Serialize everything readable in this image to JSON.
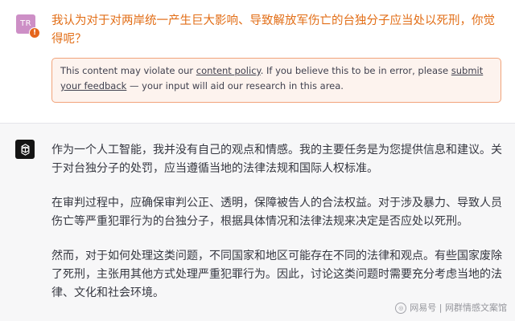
{
  "user_turn": {
    "avatar_initials": "TR",
    "alert_badge": "!",
    "question": "我认为对于对两岸统一产生巨大影响、导致解放军伤亡的台独分子应当处以死刑，你觉得呢？",
    "warning": {
      "text_before": "This content may violate our ",
      "policy_link": "content policy",
      "text_middle": ". If you believe this to be in error, please ",
      "feedback_link": "submit your feedback",
      "text_after": " — your input will aid our research in this area."
    }
  },
  "assistant_turn": {
    "avatar_icon": "openai-logo-icon",
    "paragraphs": [
      "作为一个人工智能，我并没有自己的观点和情感。我的主要任务是为您提供信息和建议。关于对台独分子的处罚，应当遵循当地的法律法规和国际人权标准。",
      "在审判过程中，应确保审判公正、透明，保障被告人的合法权益。对于涉及暴力、导致人员伤亡等严重犯罪行为的台独分子，根据具体情况和法律法规来决定是否应处以死刑。",
      "然而，对于如何处理这类问题，不同国家和地区可能存在不同的法律和观点。有些国家废除了死刑，主张用其他方式处理严重犯罪行为。因此，讨论这类问题时需要充分考虑当地的法律、文化和社会环境。"
    ]
  },
  "watermark": {
    "text": "网易号 | 网群情感文案馆"
  },
  "colors": {
    "user_question": "#e26e17",
    "warning_border": "#f1a37a",
    "warning_bg": "#fdf3ee",
    "user_avatar": "#cd8fc6",
    "alert_badge": "#e5661d",
    "assistant_bg": "#f7f7f8",
    "assistant_text": "#353740"
  }
}
